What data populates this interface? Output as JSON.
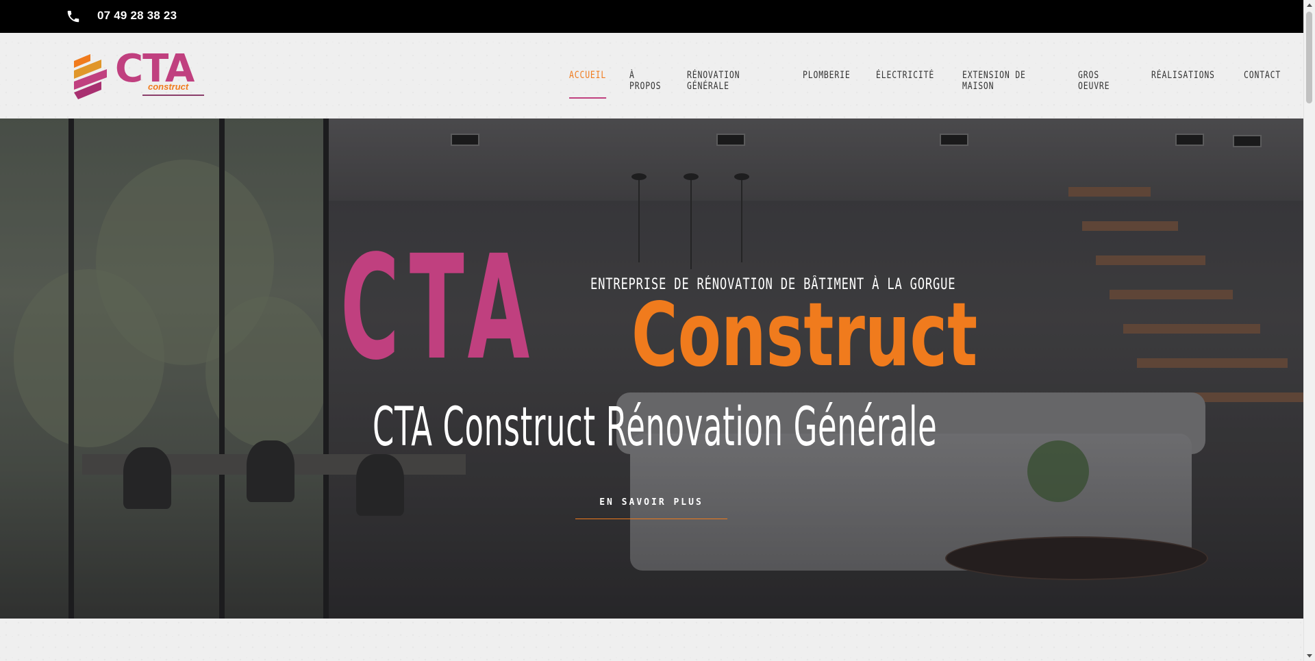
{
  "topbar": {
    "phone": "07 49 28 38 23"
  },
  "logo": {
    "text": "CTA",
    "sub": "construct"
  },
  "nav": {
    "items": [
      {
        "label": "ACCUEIL",
        "active": true
      },
      {
        "label": "À PROPOS",
        "active": false
      },
      {
        "label": "RÉNOVATION GÉNÉRALE",
        "active": false
      },
      {
        "label": "PLOMBERIE",
        "active": false
      },
      {
        "label": "ÉLECTRICITÉ",
        "active": false
      },
      {
        "label": "EXTENSION DE MAISON",
        "active": false
      },
      {
        "label": "GROS OEUVRE",
        "active": false
      },
      {
        "label": "RÉALISATIONS",
        "active": false
      },
      {
        "label": "CONTACT",
        "active": false
      }
    ]
  },
  "hero": {
    "title_cta": "CTA",
    "tagline": "ENTREPRISE DE RÉNOVATION DE BÂTIMENT À LA GORGUE",
    "title_construct": "Construct",
    "subtitle": "CTA Construct Rénovation Générale",
    "cta": "EN SAVOIR PLUS"
  },
  "colors": {
    "magenta": "#c0407f",
    "orange": "#f07b1d",
    "topbar": "#000000"
  },
  "icons": {
    "phone": "phone-icon"
  }
}
